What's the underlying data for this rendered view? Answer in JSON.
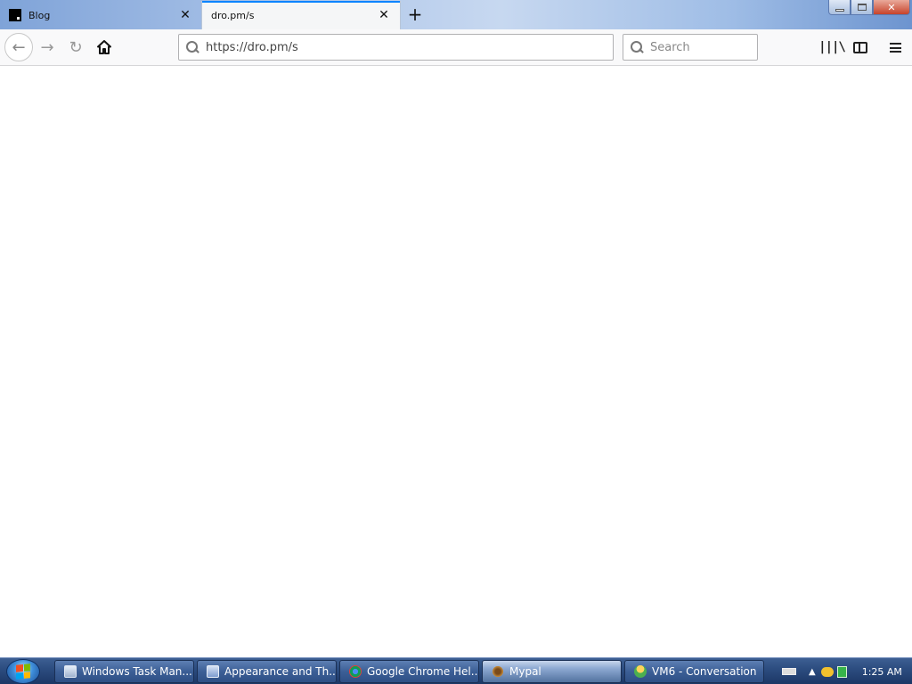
{
  "tabs": [
    {
      "title": "Blog",
      "active": false
    },
    {
      "title": "dro.pm/s",
      "active": true
    }
  ],
  "window_controls": {
    "minimize": "minimize",
    "maximize": "restore",
    "close": "✕"
  },
  "navbar": {
    "url": "https://dro.pm/s",
    "search_placeholder": "Search",
    "icons": [
      "back-arrow-icon",
      "forward-arrow-icon",
      "reload-icon",
      "home-icon",
      "library-icon",
      "sidebar-icon",
      "hamburger-menu-icon"
    ]
  },
  "taskbar": {
    "buttons": [
      {
        "label": "Windows Task Man...",
        "icon": "task-manager-icon"
      },
      {
        "label": "Appearance and Th...",
        "icon": "appearance-icon"
      },
      {
        "label": "Google Chrome Hel...",
        "icon": "chrome-icon"
      },
      {
        "label": "Mypal",
        "icon": "mypal-icon",
        "active": true
      },
      {
        "label": "VM6 - Conversation",
        "icon": "vm6-icon"
      }
    ],
    "clock": "1:25 AM"
  },
  "colors": {
    "active_tab_accent": "#0a84ff",
    "taskbar": "#2b4b7e"
  }
}
